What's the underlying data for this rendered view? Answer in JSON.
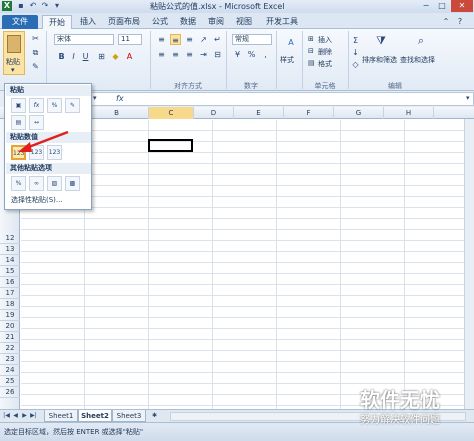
{
  "window": {
    "title": "粘贴公式的值.xlsx - Microsoft Excel",
    "minimize": "−",
    "maximize": "□",
    "close": "✕"
  },
  "tabs": [
    {
      "label": "文件"
    },
    {
      "label": "开始"
    },
    {
      "label": "插入"
    },
    {
      "label": "页面布局"
    },
    {
      "label": "公式"
    },
    {
      "label": "数据"
    },
    {
      "label": "审阅"
    },
    {
      "label": "视图"
    },
    {
      "label": "开发工具"
    }
  ],
  "ribbon": {
    "paste_label": "粘贴",
    "font_name": "宋体",
    "font_size": "11",
    "number_format": "常规",
    "styles_label": "样式",
    "insert_label": "插入",
    "delete_label": "删除",
    "format_label": "格式",
    "sort_filter_label": "排序和筛选",
    "find_select_label": "查找和选择",
    "groups": {
      "alignment": "对齐方式",
      "number": "数字",
      "cells": "单元格",
      "editing": "编辑"
    }
  },
  "paste_menu": {
    "section_paste": "粘贴",
    "section_values": "粘贴数值",
    "section_other": "其他粘贴选项",
    "paste_special": "选择性粘贴(S)..."
  },
  "grid": {
    "columns": [
      "B",
      "C",
      "D",
      "E",
      "F",
      "G",
      "H"
    ],
    "rows": [
      "12",
      "13",
      "14",
      "15",
      "16",
      "17",
      "18",
      "19",
      "20",
      "21",
      "22",
      "23",
      "24",
      "25",
      "26"
    ]
  },
  "sheets": [
    {
      "label": "Sheet1"
    },
    {
      "label": "Sheet2"
    },
    {
      "label": "Sheet3"
    }
  ],
  "status": {
    "text": "选定目标区域，然后按 ENTER 或选择\"粘贴\""
  },
  "watermark": {
    "main": "软件无忧",
    "sub": "努力解决软件问题"
  },
  "colors": {
    "accent": "#2a6db5",
    "highlight": "#e6a23c",
    "arrow": "#e02020"
  }
}
